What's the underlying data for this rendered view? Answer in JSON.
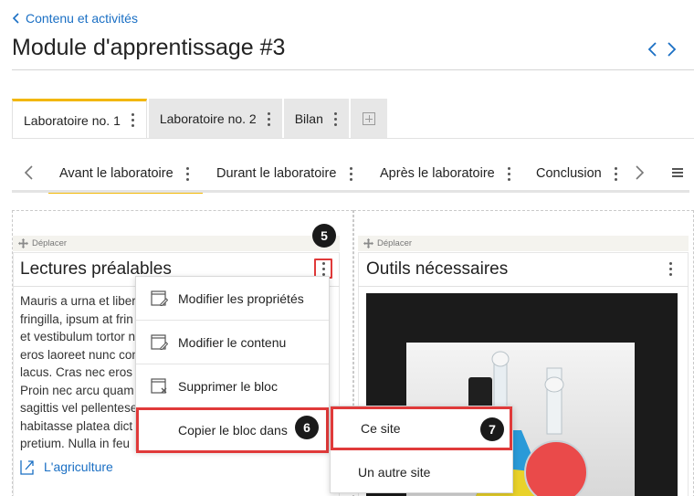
{
  "header": {
    "back_label": "Contenu et activités",
    "title": "Module d'apprentissage #3"
  },
  "tabs": [
    {
      "label": "Laboratoire no. 1",
      "active": true
    },
    {
      "label": "Laboratoire no. 2",
      "active": false
    },
    {
      "label": "Bilan",
      "active": false
    }
  ],
  "subtabs": [
    {
      "label": "Avant le laboratoire",
      "active": true
    },
    {
      "label": "Durant le laboratoire",
      "active": false
    },
    {
      "label": "Après le laboratoire",
      "active": false
    },
    {
      "label": "Conclusion",
      "active": false
    }
  ],
  "left_block": {
    "move_label": "Déplacer",
    "title": "Lectures préalables",
    "body": "Mauris a urna et liber\nfringilla, ipsum at frin\net vestibulum tortor n\neros laoreet nunc con\nlacus. Cras nec eros j\nProin nec arcu quam\nsagittis vel pellentese\nhabitasse platea dict\npretium. Nulla in feu",
    "link_label": "L'agriculture"
  },
  "right_block": {
    "move_label": "Déplacer",
    "title": "Outils nécessaires"
  },
  "context_menu": {
    "items": [
      {
        "label": "Modifier les propriétés",
        "icon": "edit-properties-icon"
      },
      {
        "label": "Modifier le contenu",
        "icon": "edit-content-icon"
      },
      {
        "label": "Supprimer le bloc",
        "icon": "delete-block-icon"
      },
      {
        "label": "Copier le bloc dans",
        "icon": ""
      }
    ]
  },
  "submenu": {
    "items": [
      {
        "label": "Ce site"
      },
      {
        "label": "Un autre site"
      }
    ]
  },
  "callouts": {
    "c5": "5",
    "c6": "6",
    "c7": "7"
  },
  "colors": {
    "accent": "#f2b705",
    "link": "#1a6fc4",
    "highlight": "#e03a3a"
  }
}
